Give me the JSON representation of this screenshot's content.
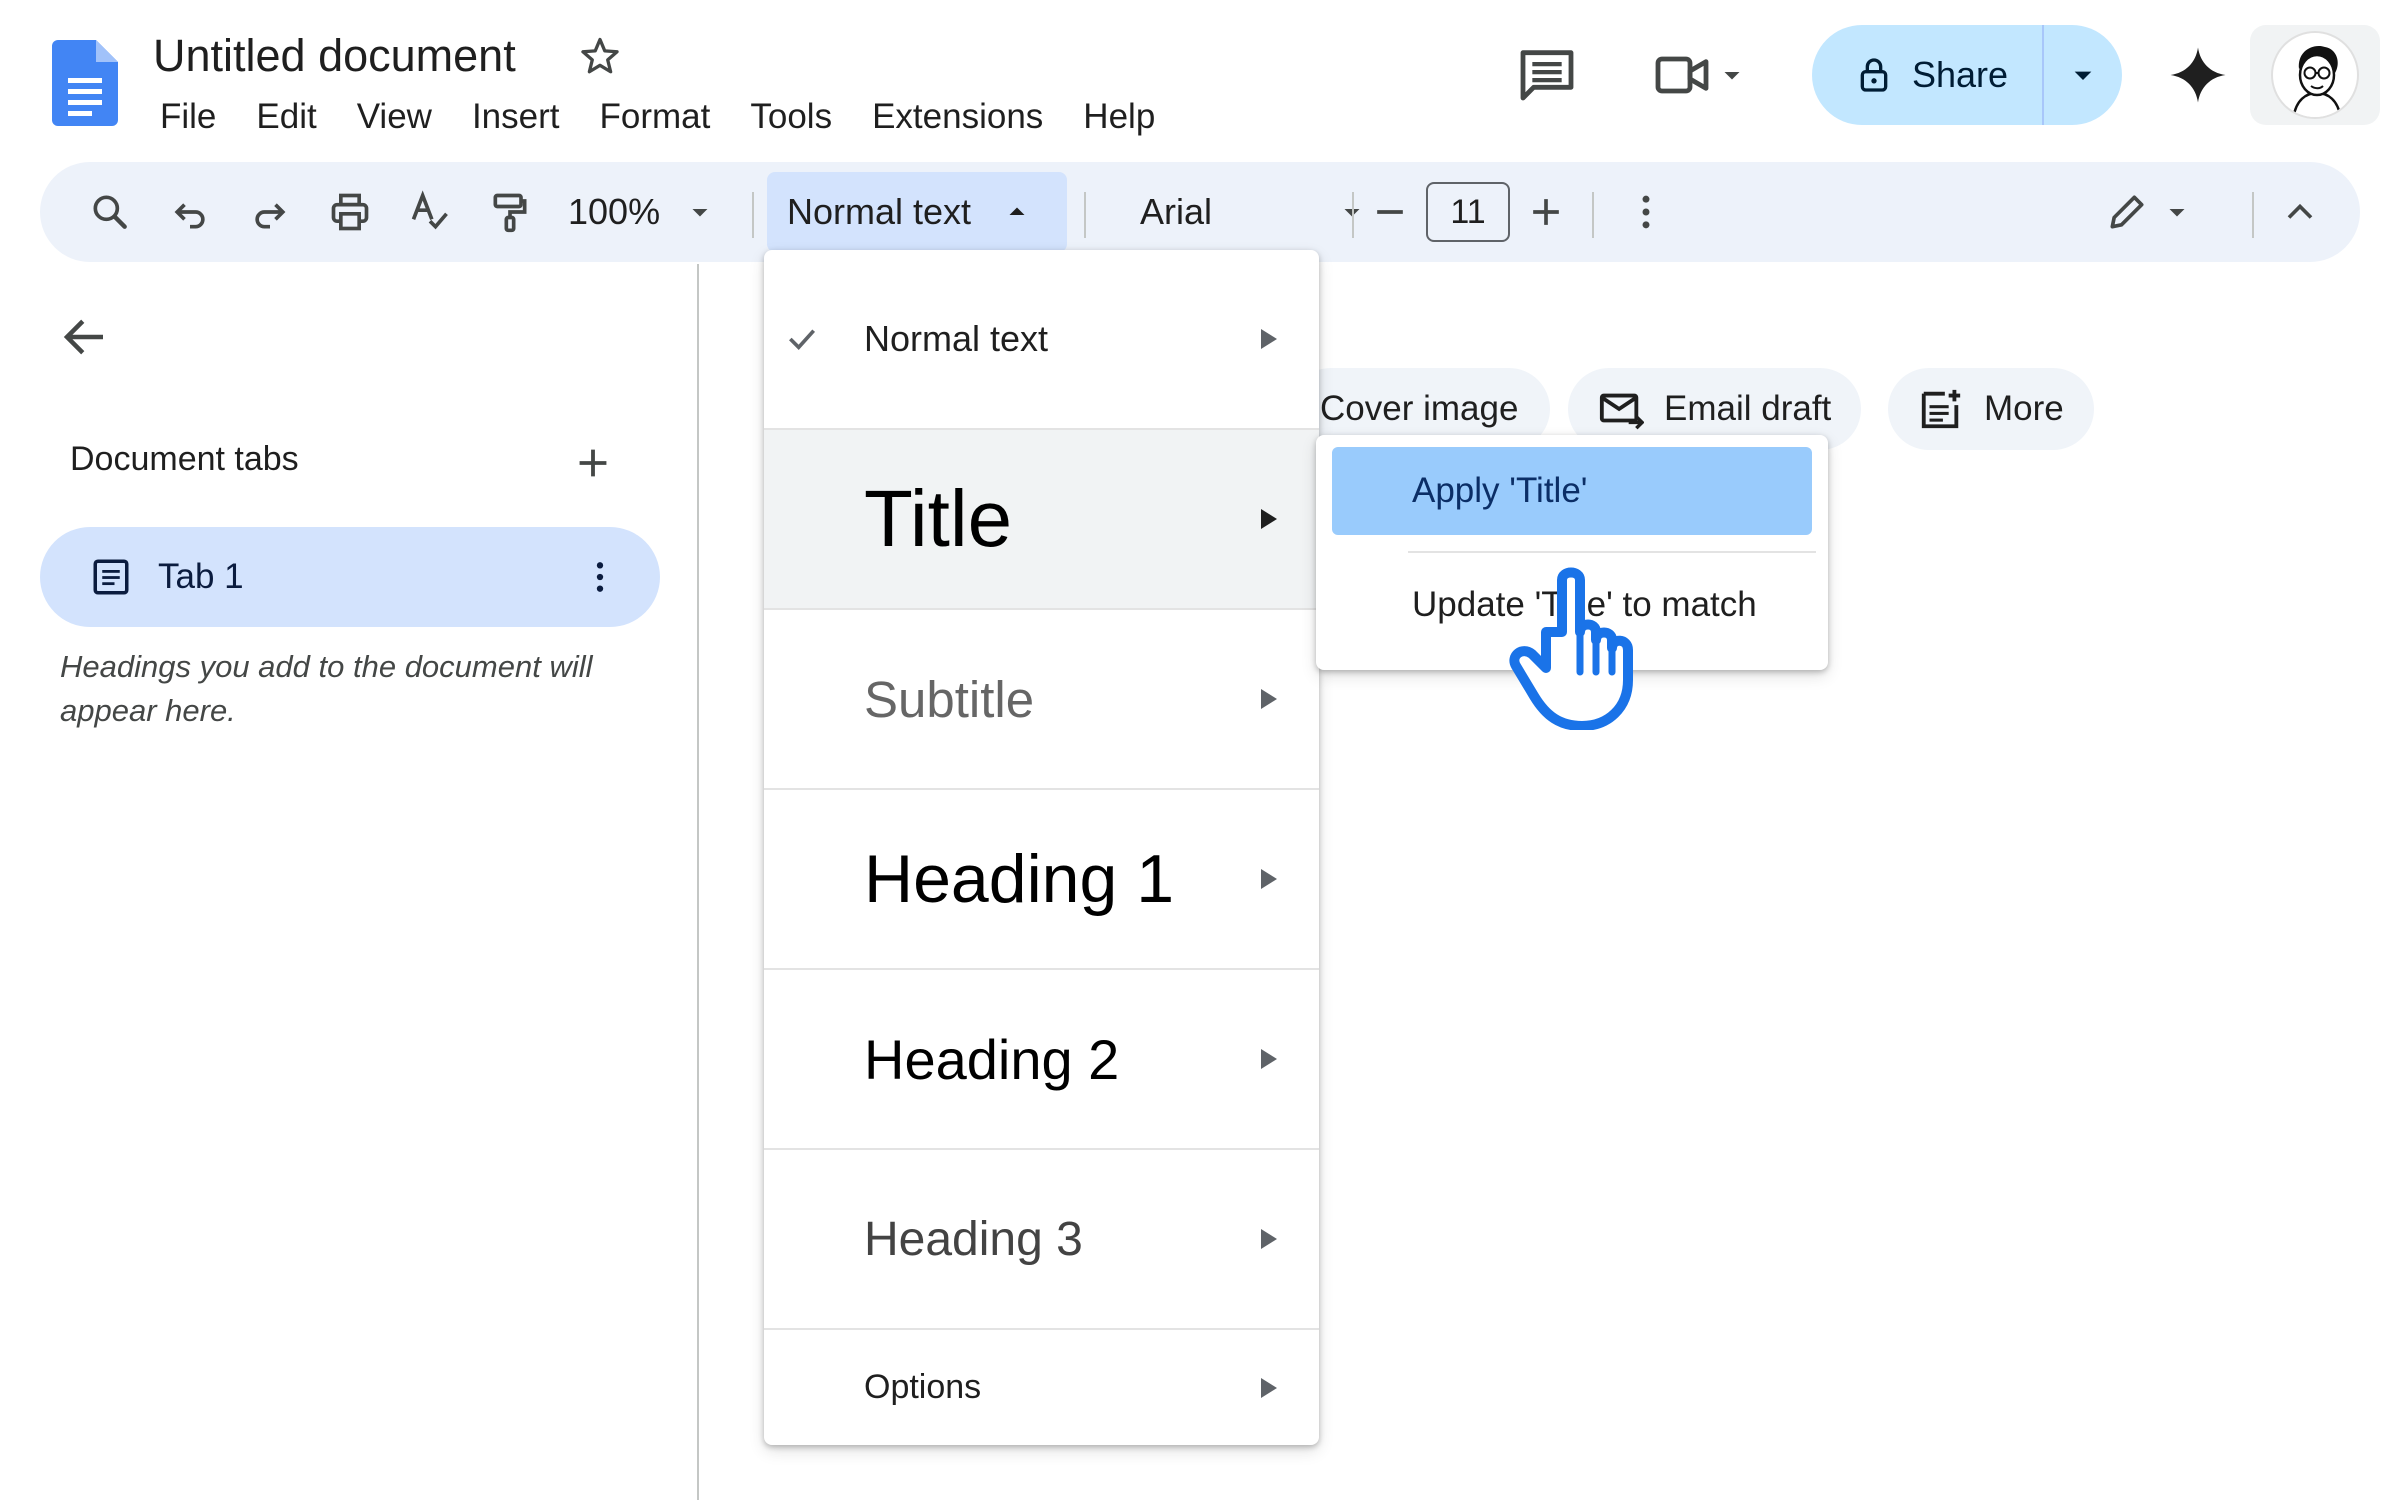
{
  "document": {
    "title": "Untitled document"
  },
  "menu": [
    "File",
    "Edit",
    "View",
    "Insert",
    "Format",
    "Tools",
    "Extensions",
    "Help"
  ],
  "header": {
    "share_label": "Share"
  },
  "toolbar": {
    "zoom": "100%",
    "style": "Normal text",
    "font": "Arial",
    "font_size": "11"
  },
  "sidebar": {
    "section_label": "Document tabs",
    "tab_label": "Tab 1",
    "hint": "Headings you add to the document will appear here."
  },
  "chips": {
    "cover_image": "Cover image",
    "email_draft": "Email draft",
    "more": "More"
  },
  "style_menu": {
    "items": [
      "Normal text",
      "Title",
      "Subtitle",
      "Heading 1",
      "Heading 2",
      "Heading 3",
      "Options"
    ],
    "selected": "Normal text",
    "hovered": "Title"
  },
  "submenu": {
    "apply": "Apply 'Title'",
    "update": "Update 'Title' to match"
  },
  "colors": {
    "share_bg": "#c2e7ff",
    "toolbar_bg": "#edf2fa",
    "selected_bg": "#d3e3fd",
    "apply_bg": "#99cbfc",
    "cursor": "#1a73e8"
  }
}
